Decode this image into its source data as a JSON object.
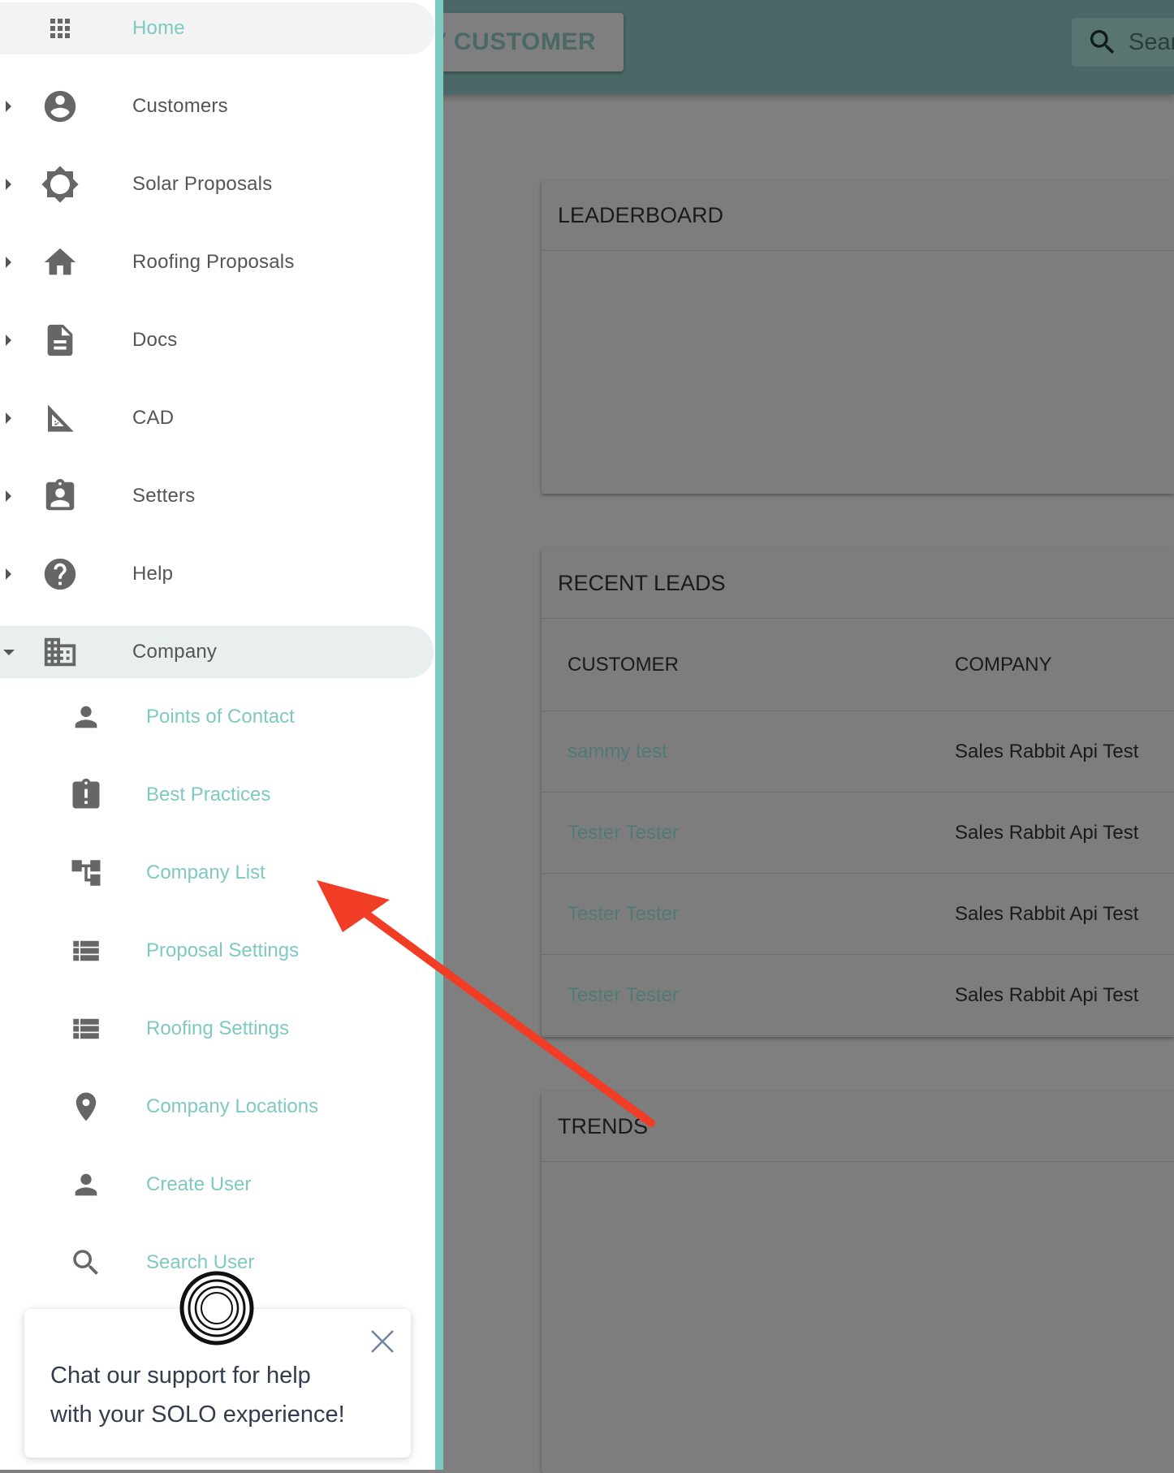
{
  "colors": {
    "accent": "#7ec9c2",
    "topbar": "#4a6865",
    "overlay": "#7f7f7f",
    "annotation_arrow": "#f23d26"
  },
  "topbar": {
    "new_customer_label": "V CUSTOMER",
    "search_placeholder": "Sear"
  },
  "sidebar": {
    "home": {
      "label": "Home",
      "icon": "apps-grid-icon"
    },
    "items": [
      {
        "label": "Customers",
        "icon": "account-circle-icon"
      },
      {
        "label": "Solar Proposals",
        "icon": "sun-icon"
      },
      {
        "label": "Roofing Proposals",
        "icon": "home-icon"
      },
      {
        "label": "Docs",
        "icon": "document-icon"
      },
      {
        "label": "CAD",
        "icon": "set-square-icon"
      },
      {
        "label": "Setters",
        "icon": "assignment-ind-icon"
      },
      {
        "label": "Help",
        "icon": "help-circle-icon"
      }
    ],
    "company": {
      "label": "Company",
      "icon": "building-icon",
      "children": [
        {
          "label": "Points of Contact",
          "icon": "person-icon"
        },
        {
          "label": "Best Practices",
          "icon": "assignment-late-icon"
        },
        {
          "label": "Company List",
          "icon": "account-tree-icon"
        },
        {
          "label": "Proposal Settings",
          "icon": "list-icon"
        },
        {
          "label": "Roofing Settings",
          "icon": "list-icon"
        },
        {
          "label": "Company Locations",
          "icon": "location-pin-icon"
        },
        {
          "label": "Create User",
          "icon": "person-icon"
        },
        {
          "label": "Search User",
          "icon": "search-icon"
        }
      ]
    }
  },
  "main": {
    "leaderboard_title": "LEADERBOARD",
    "recent_leads": {
      "title": "RECENT LEADS",
      "columns": [
        "CUSTOMER",
        "COMPANY"
      ],
      "rows": [
        {
          "customer": "sammy test",
          "company": "Sales Rabbit Api Test"
        },
        {
          "customer": "Tester Tester",
          "company": "Sales Rabbit Api Test"
        },
        {
          "customer": "Tester Tester",
          "company": "Sales Rabbit Api Test"
        },
        {
          "customer": "Tester Tester",
          "company": "Sales Rabbit Api Test"
        }
      ]
    },
    "trends_title": "TRENDS"
  },
  "chat": {
    "message": "Chat our support for help with your SOLO experience!"
  }
}
